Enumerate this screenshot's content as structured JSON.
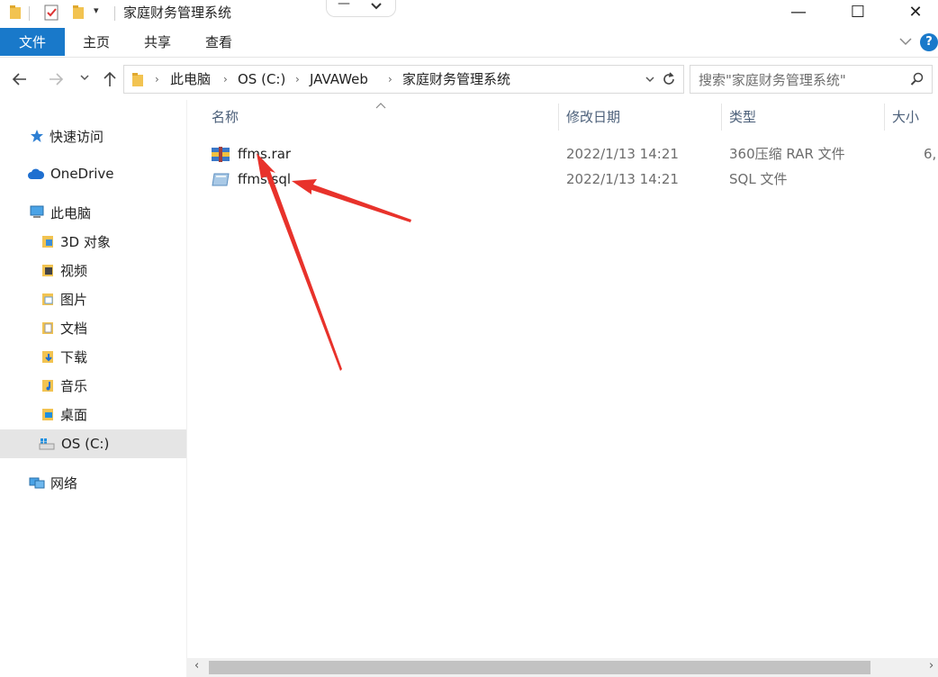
{
  "window": {
    "title": "家庭财务管理系统",
    "minimize_glyph": "—",
    "maximize_glyph": "☐",
    "close_glyph": "✕"
  },
  "ribbon": {
    "tabs": [
      {
        "label": "文件",
        "active": true
      },
      {
        "label": "主页"
      },
      {
        "label": "共享"
      },
      {
        "label": "查看"
      }
    ],
    "help_glyph": "?"
  },
  "address": {
    "crumbs": [
      "此电脑",
      "OS (C:)",
      "JAVAWeb",
      "家庭财务管理系统"
    ],
    "search_placeholder": "搜索\"家庭财务管理系统\""
  },
  "nav": {
    "quick_access": "快速访问",
    "onedrive": "OneDrive",
    "this_pc": "此电脑",
    "children": [
      "3D 对象",
      "视频",
      "图片",
      "文档",
      "下载",
      "音乐",
      "桌面",
      "OS (C:)"
    ],
    "selected": "OS (C:)",
    "network": "网络"
  },
  "columns": {
    "name": "名称",
    "modified": "修改日期",
    "type": "类型",
    "size": "大小"
  },
  "files": [
    {
      "name": "ffms.rar",
      "modified": "2022/1/13 14:21",
      "type": "360压缩 RAR 文件",
      "size": "6,"
    },
    {
      "name": "ffms.sql",
      "modified": "2022/1/13 14:21",
      "type": "SQL 文件",
      "size": ""
    }
  ],
  "colors": {
    "accent": "#1979ca",
    "annotation_arrow": "#e8322b"
  }
}
